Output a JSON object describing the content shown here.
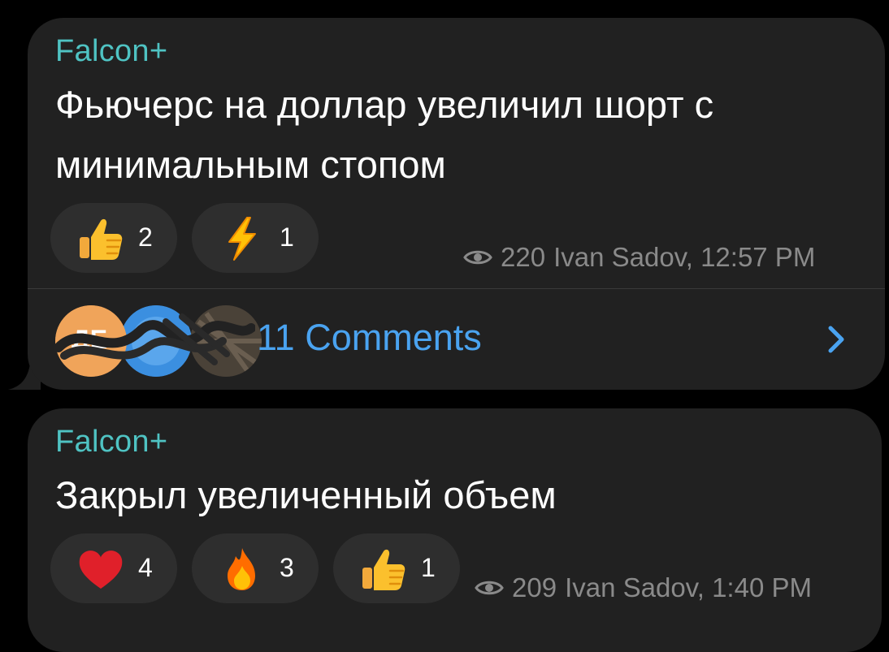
{
  "messages": [
    {
      "author": "Falcon+",
      "text_line1": "Фьючерс на доллар увеличил шорт с",
      "text_line2": "минимальным стопом",
      "reactions": [
        {
          "emoji": "thumbs-up",
          "count": "2"
        },
        {
          "emoji": "high-voltage",
          "count": "1"
        }
      ],
      "views": "220",
      "signature": "Ivan Sadov, 12:57 PM",
      "comments": {
        "label": "11 Comments",
        "first_avatar_text": "ДЕ"
      }
    },
    {
      "author": "Falcon+",
      "text_line1": "Закрыл увеличенный объем",
      "reactions": [
        {
          "emoji": "red-heart",
          "count": "4"
        },
        {
          "emoji": "fire",
          "count": "3"
        },
        {
          "emoji": "thumbs-up",
          "count": "1"
        }
      ],
      "views": "209",
      "signature": "Ivan Sadov, 1:40 PM"
    }
  ],
  "colors": {
    "background": "#000000",
    "bubble": "#212121",
    "reaction_pill": "#2e2e2e",
    "author": "#4fc3c3",
    "link": "#4aa3f0",
    "meta": "#8a8a8a"
  }
}
